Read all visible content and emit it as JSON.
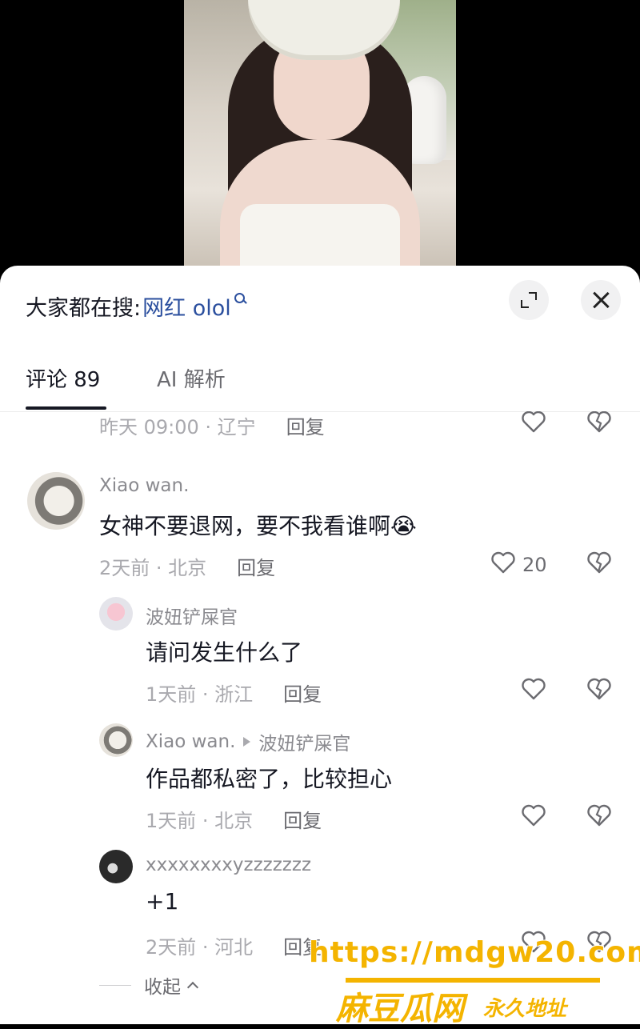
{
  "search_bar": {
    "prefix": "大家都在搜:",
    "keyword": "网红 olol"
  },
  "tabs": [
    {
      "label": "评论 89",
      "active": true
    },
    {
      "label": "AI 解析",
      "active": false
    }
  ],
  "comments": {
    "top_partial": {
      "meta": "昨天 09:00 · 辽宁",
      "reply": "回复"
    },
    "main": {
      "username": "Xiao wan.",
      "text": "女神不要退网，要不我看谁啊😭",
      "meta": "2天前 · 北京",
      "reply": "回复",
      "likes": "20"
    },
    "replies": [
      {
        "username": "波妞铲屎官",
        "text": "请问发生什么了",
        "meta": "1天前 · 浙江",
        "reply": "回复"
      },
      {
        "username": "Xiao wan.",
        "reply_to": "波妞铲屎官",
        "text": "作品都私密了，比较担心",
        "meta": "1天前 · 北京",
        "reply": "回复"
      },
      {
        "username": "xxxxxxxxyzzzzzzz",
        "text": "+1",
        "meta": "2天前 · 河北",
        "reply": "回复"
      }
    ],
    "collapse_label": "收起"
  },
  "watermark": {
    "url": "https://mdgw20.com",
    "name": "麻豆瓜网",
    "sub": "永久地址"
  },
  "colors": {
    "keyword": "#2b4f9e",
    "watermark": "#f4b400"
  }
}
